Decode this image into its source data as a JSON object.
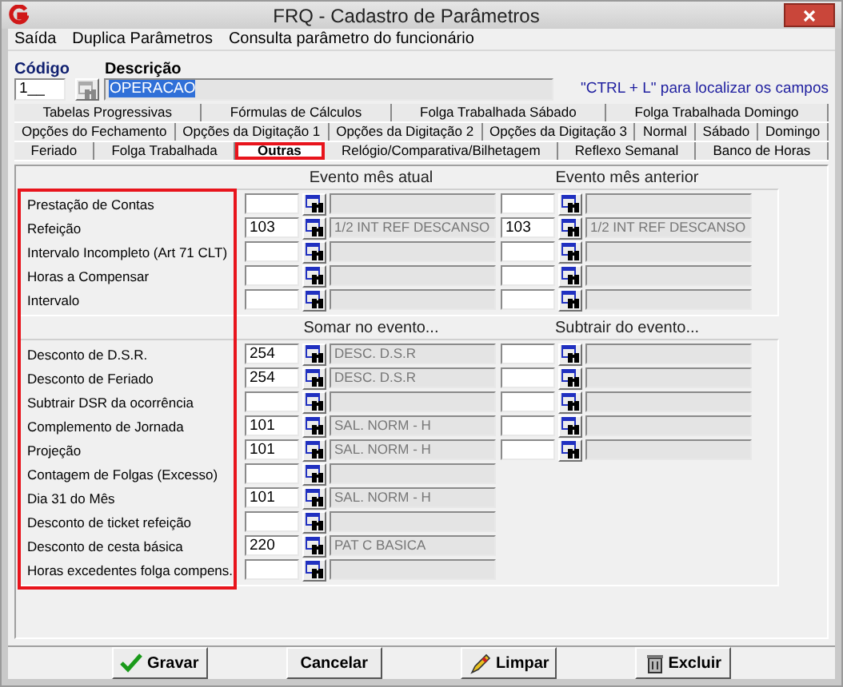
{
  "window": {
    "title": "FRQ - Cadastro de Parâmetros"
  },
  "menu": [
    {
      "label": "Saída"
    },
    {
      "label": "Duplica Parâmetros"
    },
    {
      "label": "Consulta parâmetro do funcionário"
    }
  ],
  "header": {
    "code_label": "Código",
    "code_value": "1__",
    "description_label": "Descrição",
    "description_value": "OPERACAO",
    "description_selected": true,
    "hint": "\"CTRL + L\" para localizar os campos"
  },
  "tab_rows": [
    [
      {
        "label": "Tabelas Progressivas",
        "selected": false,
        "highlighted": false
      },
      {
        "label": "Fórmulas de Cálculos",
        "selected": false,
        "highlighted": false
      },
      {
        "label": "Folga Trabalhada Sábado",
        "selected": false,
        "highlighted": false
      },
      {
        "label": "Folga Trabalhada Domingo",
        "selected": false,
        "highlighted": false
      }
    ],
    [
      {
        "label": "Opções do Fechamento",
        "selected": false,
        "highlighted": false
      },
      {
        "label": "Opções da Digitação 1",
        "selected": false,
        "highlighted": false
      },
      {
        "label": "Opções da Digitação 2",
        "selected": false,
        "highlighted": false
      },
      {
        "label": "Opções da Digitação 3",
        "selected": false,
        "highlighted": false
      },
      {
        "label": "Normal",
        "selected": false,
        "highlighted": false
      },
      {
        "label": "Sábado",
        "selected": false,
        "highlighted": false
      },
      {
        "label": "Domingo",
        "selected": false,
        "highlighted": false
      }
    ],
    [
      {
        "label": "Feriado",
        "selected": false,
        "highlighted": false
      },
      {
        "label": "Folga Trabalhada",
        "selected": false,
        "highlighted": false
      },
      {
        "label": "Outras",
        "selected": true,
        "highlighted": true
      },
      {
        "label": "Relógio/Comparativa/Bilhetagem",
        "selected": false,
        "highlighted": false
      },
      {
        "label": "Reflexo Semanal",
        "selected": false,
        "highlighted": false
      },
      {
        "label": "Banco de Horas",
        "selected": false,
        "highlighted": false
      }
    ]
  ],
  "labels_highlighted": true,
  "groups": [
    {
      "headers": [
        "Evento mês atual",
        "Evento mês anterior"
      ],
      "rows": [
        {
          "label": "Prestação de Contas",
          "kind": "pair"
        },
        {
          "label": "Refeição",
          "kind": "pair",
          "left": {
            "code": "103",
            "description": "1/2 INT REF DESCANSO"
          },
          "right": {
            "code": "103",
            "description": "1/2 INT REF DESCANSO"
          }
        },
        {
          "label": "Intervalo Incompleto (Art 71 CLT)",
          "kind": "pair"
        },
        {
          "label": "Horas a Compensar",
          "kind": "pair"
        },
        {
          "label": "Intervalo",
          "kind": "pair"
        }
      ]
    },
    {
      "headers": [
        "Somar no evento...",
        "Subtrair do evento..."
      ],
      "rows": [
        {
          "label": "Desconto de D.S.R.",
          "kind": "pair",
          "left": {
            "code": "254",
            "description": "DESC. D.S.R"
          }
        },
        {
          "label": "Desconto de Feriado",
          "kind": "pair",
          "left": {
            "code": "254",
            "description": "DESC. D.S.R"
          }
        },
        {
          "label": "Subtrair DSR da ocorrência",
          "kind": "pair"
        },
        {
          "label": "Complemento de Jornada",
          "kind": "pair",
          "left": {
            "code": "101",
            "description": "SAL. NORM - H"
          }
        },
        {
          "label": "Projeção",
          "kind": "pair",
          "left": {
            "code": "101",
            "description": "SAL. NORM - H"
          }
        },
        {
          "label": "Contagem de Folgas (Excesso)",
          "kind": "single"
        },
        {
          "label": "Dia 31  do Mês",
          "kind": "single",
          "left": {
            "code": "101",
            "description": "SAL. NORM - H"
          }
        },
        {
          "label": "Desconto de ticket refeição",
          "kind": "single"
        },
        {
          "label": "Desconto de cesta básica",
          "kind": "single",
          "left": {
            "code": "220",
            "description": "PAT C BASICA"
          }
        },
        {
          "label": "Horas excedentes folga compens.",
          "kind": "single"
        }
      ]
    }
  ],
  "buttons": [
    {
      "label": "Gravar",
      "kind": "check"
    },
    {
      "label": "Cancelar",
      "kind": "none"
    },
    {
      "label": "Limpar",
      "kind": "eraser"
    },
    {
      "label": "Excluir",
      "kind": "trash"
    }
  ]
}
